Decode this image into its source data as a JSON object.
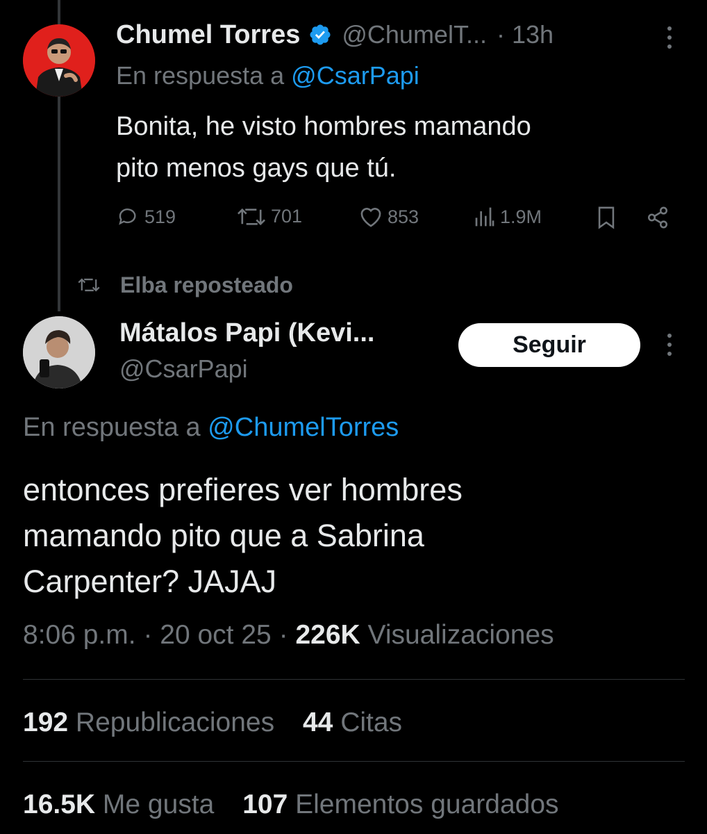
{
  "reply_tweet": {
    "author_name": "Chumel Torres",
    "author_handle": "@ChumelT...",
    "time": "· 13h",
    "reply_prefix": "En respuesta a",
    "reply_to": "@CsarPapi",
    "text_line1": "Bonita, he visto hombres mamando",
    "text_line2": "pito menos gays que tú.",
    "replies": "519",
    "reposts": "701",
    "likes": "853",
    "views": "1.9M"
  },
  "repost_context": {
    "label": "Elba reposteado"
  },
  "main_tweet": {
    "author_name": "Mátalos Papi (Kevi...",
    "author_handle": "@CsarPapi",
    "follow_label": "Seguir",
    "reply_prefix": "En respuesta a",
    "reply_to": "@ChumelTorres",
    "text_line1": "entonces prefieres ver hombres",
    "text_line2": "mamando pito que a Sabrina",
    "text_line3": "Carpenter? JAJAJ",
    "time": "8:06 p.m.",
    "date": "20 oct 25",
    "views_count": "226K",
    "views_label": "Visualizaciones",
    "reposts_count": "192",
    "reposts_label": "Republicaciones",
    "quotes_count": "44",
    "quotes_label": "Citas",
    "likes_count": "16.5K",
    "likes_label": "Me gusta",
    "bookmarks_count": "107",
    "bookmarks_label": "Elementos guardados"
  },
  "colors": {
    "background": "#000000",
    "text": "#e7e9ea",
    "muted": "#71767b",
    "link": "#1d9bf0",
    "avatar_red": "#e0201c"
  }
}
